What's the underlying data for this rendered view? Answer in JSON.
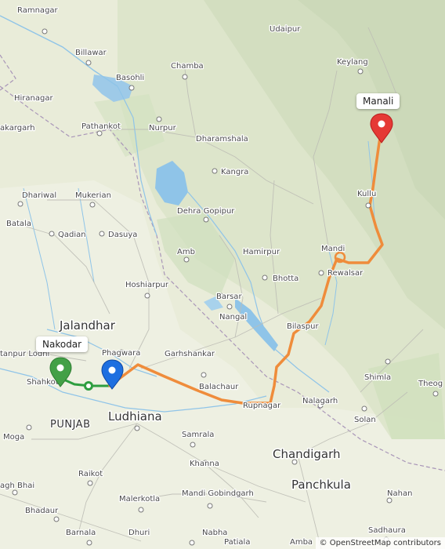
{
  "map": {
    "labels": {
      "ramnagar": "Ramnagar",
      "udaipur": "Udaipur",
      "billawar": "Billawar",
      "chamba": "Chamba",
      "keylang": "Keylang",
      "basohli": "Basohli",
      "hiranagar": "Hiranagar",
      "akargarh": "akargarh",
      "pathankot": "Pathankot",
      "nurpur": "Nurpur",
      "dharamshala": "Dharamshala",
      "kangra": "Kangra",
      "dhariwal": "Dhariwal",
      "mukerian": "Mukerian",
      "dehra_gopipur": "Dehra Gopipur",
      "kullu": "Kullu",
      "batala": "Batala",
      "qadian": "Qadian",
      "dasuya": "Dasuya",
      "amb": "Amb",
      "hamirpur": "Hamirpur",
      "mandi": "Mandi",
      "rewalsar": "Rewalsar",
      "bhotta": "Bhotta",
      "hoshiarpur": "Hoshiarpur",
      "barsar": "Barsar",
      "nangal": "Nangal",
      "bilaspur": "Bilaspur",
      "jalandhar": "Jalandhar",
      "phagwara": "Phagwara",
      "garhshankar": "Garhshankar",
      "tanpur_lodhi": "tanpur Lodhi",
      "shahkot": "Shahkot",
      "balachaur": "Balachaur",
      "shimla": "Shimla",
      "theog": "Theog",
      "rupnagar": "Rupnagar",
      "nalagarh": "Nalagarh",
      "ludhiana": "Ludhiana",
      "punjab": "PUNJAB",
      "samrala": "Samrala",
      "solan": "Solan",
      "moga": "Moga",
      "chandigarh": "Chandigarh",
      "khanna": "Khanna",
      "raikot": "Raikot",
      "panchkula": "Panchkula",
      "agh_bhai": "agh Bhai",
      "malerkotla": "Malerkotla",
      "mandi_gobindgarh": "Mandi Gobindgarh",
      "nahan": "Nahan",
      "bhadaur": "Bhadaur",
      "dhuri": "Dhuri",
      "nabha": "Nabha",
      "sadhaura": "Sadhaura",
      "barnala": "Barnala",
      "patiala": "Patiala",
      "ambala": "Amba"
    },
    "route": {
      "main_color": "#ef8c3b",
      "alt_color": "#2e9e40"
    },
    "markers": {
      "destination": {
        "label": "Manali",
        "color": "#e53935"
      },
      "origin": {
        "label": "Nakodar",
        "color": "#43a047"
      },
      "waypoint": {
        "color": "#1e6fe0"
      }
    },
    "attribution": "© OpenStreetMap contributors"
  }
}
